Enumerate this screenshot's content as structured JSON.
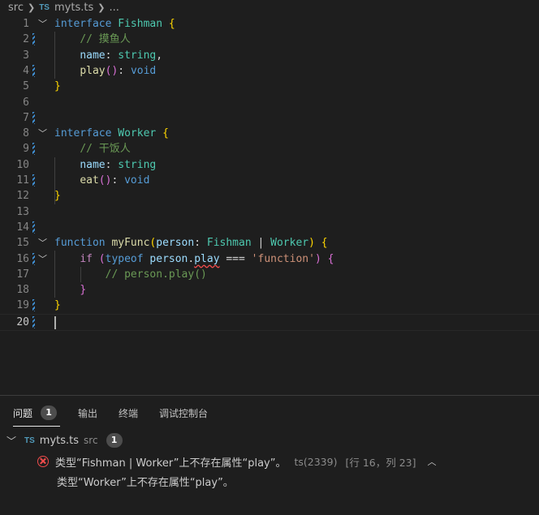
{
  "breadcrumb": {
    "folder": "src",
    "lang_badge": "TS",
    "file": "myts.ts",
    "more": "..."
  },
  "editor": {
    "active_line": 20,
    "line_numbers": [
      "1",
      "2",
      "3",
      "4",
      "5",
      "6",
      "7",
      "8",
      "9",
      "10",
      "11",
      "12",
      "13",
      "14",
      "15",
      "16",
      "17",
      "18",
      "19",
      "20"
    ]
  },
  "panel": {
    "tabs": [
      {
        "label": "问题",
        "count": "1"
      },
      {
        "label": "输出"
      },
      {
        "label": "终端"
      },
      {
        "label": "调试控制台"
      }
    ],
    "file": {
      "lang_badge": "TS",
      "name": "myts.ts",
      "folder": "src",
      "count": "1"
    },
    "problem": {
      "message": "类型“Fishman | Worker”上不存在属性“play”。",
      "source": "ts(2339)",
      "location": "[行 16，列 23]",
      "detail": "类型“Worker”上不存在属性“play”。"
    }
  },
  "colors": {
    "keyword": "#569cd6",
    "type": "#4ec9b0",
    "error": "#f14c4c"
  }
}
